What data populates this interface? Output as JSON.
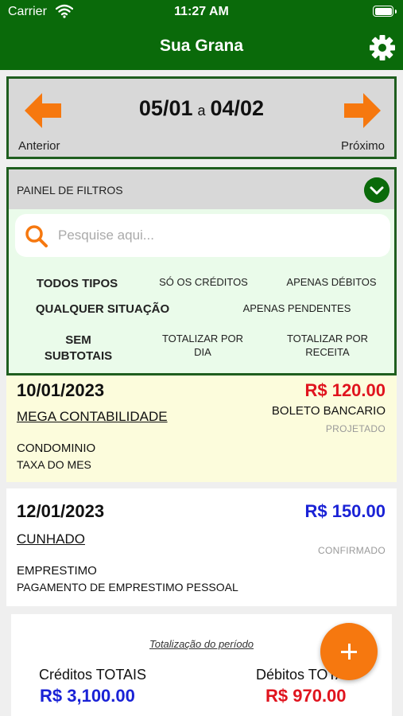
{
  "status_bar": {
    "carrier": "Carrier",
    "time": "11:27 AM"
  },
  "app": {
    "title": "Sua Grana"
  },
  "period": {
    "start": "05/01",
    "separator": "a",
    "end": "04/02",
    "prev_label": "Anterior",
    "next_label": "Próximo"
  },
  "filters": {
    "title": "PAINEL DE FILTROS",
    "search_placeholder": "Pesquise aqui...",
    "type_options": [
      "TODOS TIPOS",
      "SÓ OS CRÉDITOS",
      "APENAS DÉBITOS"
    ],
    "status_options": [
      "QUALQUER SITUAÇÃO",
      "APENAS PENDENTES"
    ],
    "subtotal_options": [
      "SEM SUBTOTAIS",
      "TOTALIZAR POR DIA",
      "TOTALIZAR POR RECEITA"
    ]
  },
  "entries": [
    {
      "date": "10/01/2023",
      "amount": "R$ 120.00",
      "party": "MEGA CONTABILIDADE",
      "payment_type": "BOLETO BANCARIO",
      "status": "PROJETADO",
      "category": "CONDOMINIO",
      "description": "TAXA DO MES"
    },
    {
      "date": "12/01/2023",
      "amount": "R$ 150.00",
      "party": "CUNHADO",
      "payment_type": "",
      "status": "CONFIRMADO",
      "category": "EMPRESTIMO",
      "description": "PAGAMENTO DE EMPRESTIMO PESSOAL"
    }
  ],
  "totals": {
    "caption": "Totalização do período",
    "credits_label": "Créditos TOTAIS",
    "credits_value": "R$ 3,100.00",
    "debits_label": "Débitos TOTAIS",
    "debits_value": "R$ 970.00"
  },
  "colors": {
    "brand_green": "#0a6a0a",
    "accent_orange": "#f6780f",
    "credit_blue": "#1a22d6",
    "debit_red": "#e0141e"
  },
  "icons": [
    "wifi-icon",
    "battery-icon",
    "gear-icon",
    "arrow-left-icon",
    "arrow-right-icon",
    "chevron-down-icon",
    "search-icon",
    "plus-icon"
  ]
}
